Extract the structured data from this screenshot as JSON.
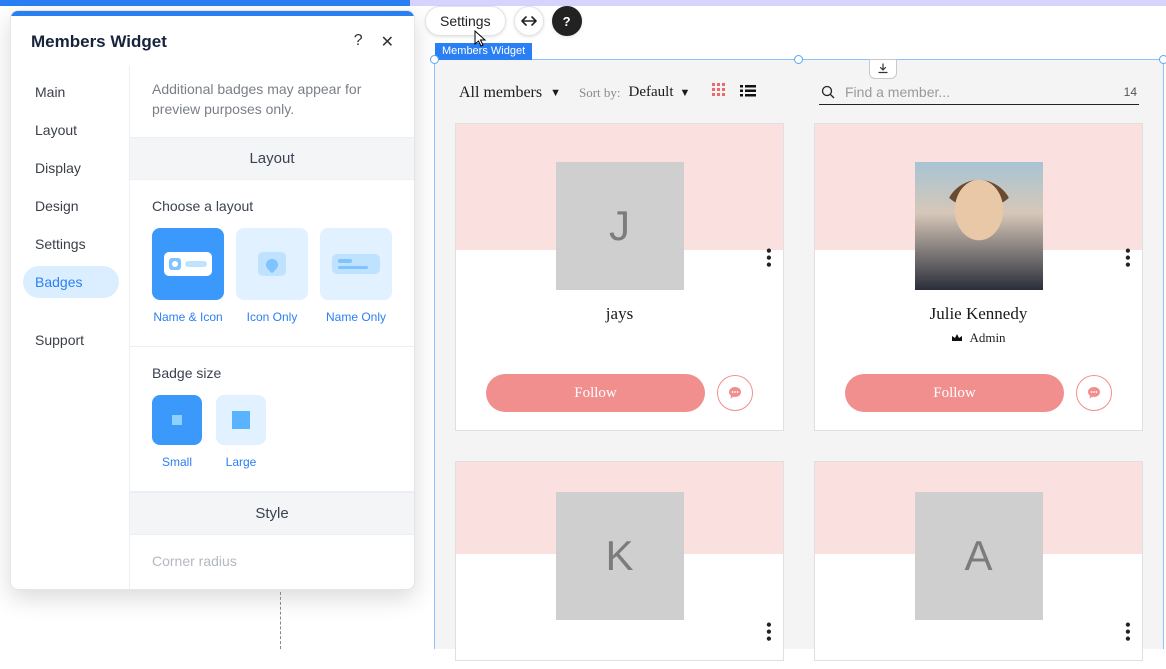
{
  "toolbar": {
    "settings_label": "Settings"
  },
  "panel": {
    "title": "Members Widget",
    "tabs": [
      "Main",
      "Layout",
      "Display",
      "Design",
      "Settings",
      "Badges",
      "Support"
    ],
    "active_tab_index": 5,
    "note": "Additional badges may appear for preview purposes only.",
    "section_layout_title": "Layout",
    "choose_layout_label": "Choose a layout",
    "layout_options": [
      "Name & Icon",
      "Icon Only",
      "Name Only"
    ],
    "layout_selected_index": 0,
    "badge_size_label": "Badge size",
    "size_options": [
      "Small",
      "Large"
    ],
    "size_selected_index": 0,
    "section_style_title": "Style",
    "corner_radius_label": "Corner radius"
  },
  "widget": {
    "tag": "Members Widget",
    "filter_label": "All members",
    "sort_label": "Sort by:",
    "sort_value": "Default",
    "search_placeholder": "Find a member...",
    "result_count": "14",
    "follow_label": "Follow",
    "members": [
      {
        "initial": "J",
        "name": "jays",
        "role": "",
        "photo": false
      },
      {
        "initial": "",
        "name": "Julie Kennedy",
        "role": "Admin",
        "photo": true
      },
      {
        "initial": "K",
        "name": "",
        "role": "",
        "photo": false
      },
      {
        "initial": "A",
        "name": "",
        "role": "",
        "photo": false
      }
    ]
  }
}
